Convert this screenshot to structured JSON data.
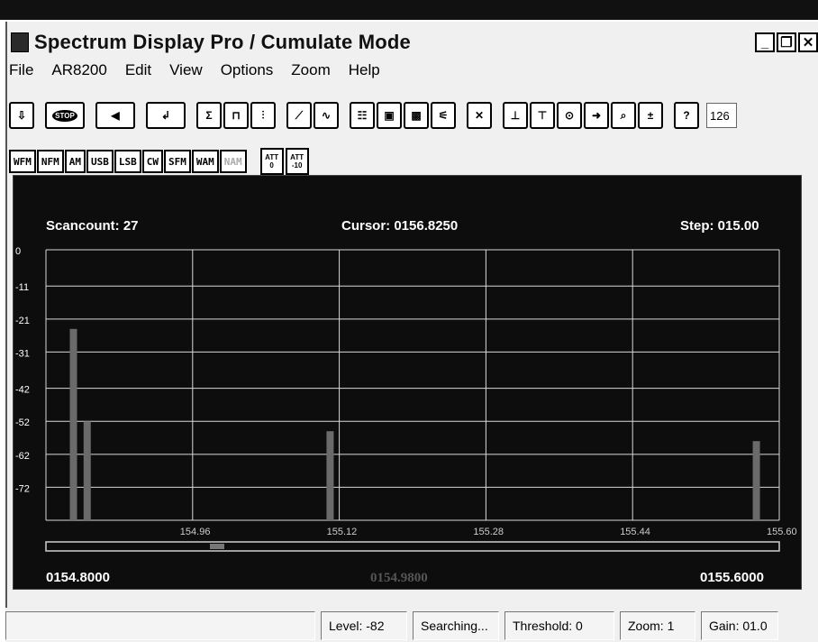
{
  "window": {
    "title": "Spectrum Display Pro / Cumulate Mode"
  },
  "menu": [
    "File",
    "AR8200",
    "Edit",
    "View",
    "Options",
    "Zoom",
    "Help"
  ],
  "toolbar": {
    "stop_label": "STOP",
    "field_value": "126"
  },
  "modes": [
    {
      "label": "WFM",
      "enabled": true
    },
    {
      "label": "NFM",
      "enabled": true
    },
    {
      "label": "AM",
      "enabled": true
    },
    {
      "label": "USB",
      "enabled": true
    },
    {
      "label": "LSB",
      "enabled": true
    },
    {
      "label": "CW",
      "enabled": true
    },
    {
      "label": "SFM",
      "enabled": true
    },
    {
      "label": "WAM",
      "enabled": true
    },
    {
      "label": "NAM",
      "enabled": false
    }
  ],
  "att": [
    {
      "top": "ATT",
      "bottom": "0"
    },
    {
      "top": "ATT",
      "bottom": "-10"
    }
  ],
  "display": {
    "scancount": "Scancount: 27",
    "cursor": "Cursor: 0156.8250",
    "step": "Step: 015.00",
    "start_freq": "0154.8000",
    "center_freq": "0154.9800",
    "end_freq": "0155.6000"
  },
  "chart_data": {
    "type": "bar",
    "xlim": [
      154.8,
      155.6
    ],
    "ylim": [
      -82,
      0
    ],
    "y_ticks": [
      "0",
      "-11",
      "-21",
      "-31",
      "-42",
      "-52",
      "-62",
      "-72"
    ],
    "x_ticks": [
      "154.96",
      "155.12",
      "155.28",
      "155.44",
      "155.60"
    ],
    "grid": true,
    "series": [
      {
        "x": [
          154.83,
          154.845,
          155.11,
          155.575
        ],
        "values": [
          -24,
          -52,
          -55,
          -58
        ]
      }
    ]
  },
  "status": {
    "blank": "",
    "level": "Level: -82",
    "state": "Searching...",
    "threshold": "Threshold: 0",
    "zoom": "Zoom: 1",
    "gain": "Gain: 01.0"
  },
  "colors": {
    "display_bg": "#0d0d0d",
    "grid": "#d8d8d8",
    "bar": "#6a6a6a",
    "text": "#ffffff"
  }
}
